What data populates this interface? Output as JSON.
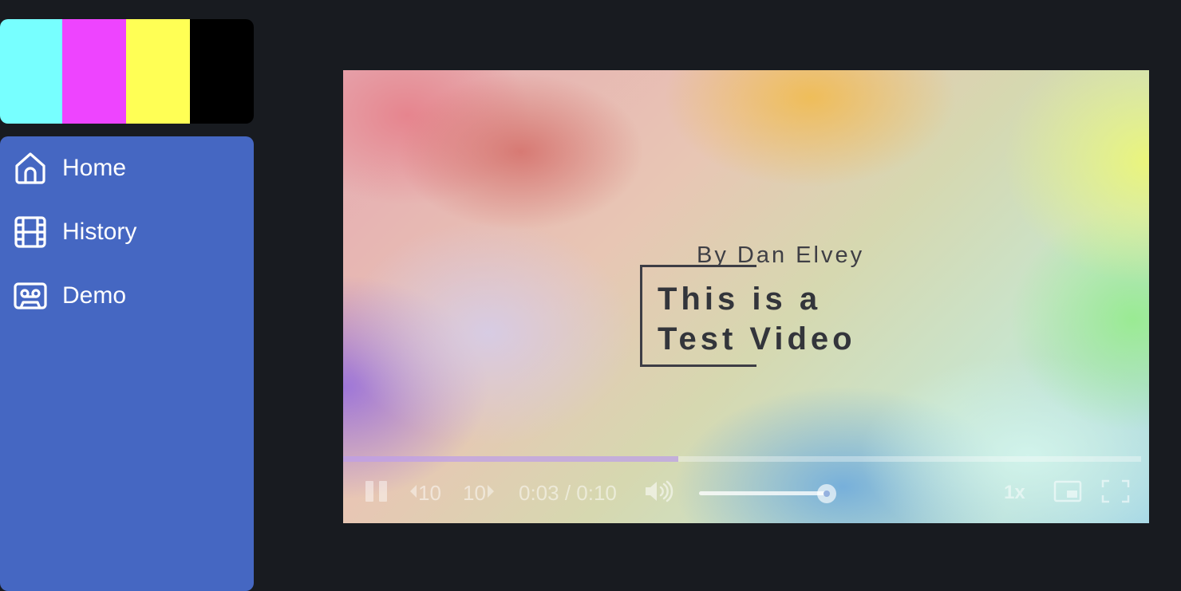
{
  "logo": {
    "colors": [
      "#77ffff",
      "#ee44ff",
      "#ffff55",
      "#000000"
    ]
  },
  "theme": {
    "sidebar_bg": "#4567c2",
    "page_bg": "#181b20"
  },
  "sidebar": {
    "items": [
      {
        "label": "Home",
        "icon": "home-icon"
      },
      {
        "label": "History",
        "icon": "film-icon"
      },
      {
        "label": "Demo",
        "icon": "cassette-icon"
      }
    ]
  },
  "video": {
    "byline": "By Dan Elvey",
    "headline_line1": "This is a",
    "headline_line2": "Test Video",
    "progress_fraction": 0.3,
    "volume_fraction": 1.0,
    "controls": {
      "rewind_label": "10",
      "forward_label": "10",
      "time_display": "0:03 / 0:10",
      "speed_label": "1x"
    }
  }
}
